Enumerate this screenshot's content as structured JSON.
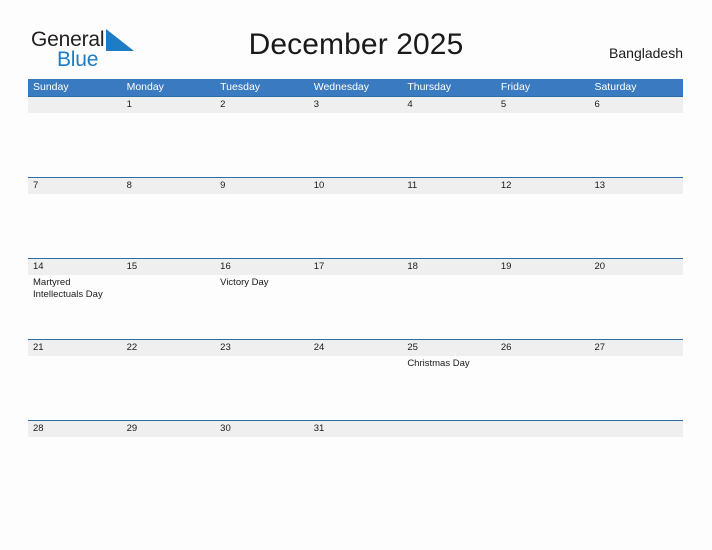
{
  "brand": {
    "name_part1": "General",
    "name_part2": "Blue",
    "flag_icon": "blue-flag-triangle",
    "color_dark": "#231f20",
    "color_blue": "#1d7cc4"
  },
  "header": {
    "title": "December 2025",
    "country": "Bangladesh"
  },
  "theme": {
    "header_bar": "#3a7ac0",
    "row_rule": "#2d6ca8",
    "date_band": "#efefef",
    "page_background": "#fdfdfd",
    "text": "#1a1a1a"
  },
  "weekday_headers": [
    "Sunday",
    "Monday",
    "Tuesday",
    "Wednesday",
    "Thursday",
    "Friday",
    "Saturday"
  ],
  "weeks": [
    {
      "days": [
        {
          "date": "",
          "events": []
        },
        {
          "date": "1",
          "events": []
        },
        {
          "date": "2",
          "events": []
        },
        {
          "date": "3",
          "events": []
        },
        {
          "date": "4",
          "events": []
        },
        {
          "date": "5",
          "events": []
        },
        {
          "date": "6",
          "events": []
        }
      ]
    },
    {
      "days": [
        {
          "date": "7",
          "events": []
        },
        {
          "date": "8",
          "events": []
        },
        {
          "date": "9",
          "events": []
        },
        {
          "date": "10",
          "events": []
        },
        {
          "date": "11",
          "events": []
        },
        {
          "date": "12",
          "events": []
        },
        {
          "date": "13",
          "events": []
        }
      ]
    },
    {
      "days": [
        {
          "date": "14",
          "events": [
            "Martyred Intellectuals Day"
          ]
        },
        {
          "date": "15",
          "events": []
        },
        {
          "date": "16",
          "events": [
            "Victory Day"
          ]
        },
        {
          "date": "17",
          "events": []
        },
        {
          "date": "18",
          "events": []
        },
        {
          "date": "19",
          "events": []
        },
        {
          "date": "20",
          "events": []
        }
      ]
    },
    {
      "days": [
        {
          "date": "21",
          "events": []
        },
        {
          "date": "22",
          "events": []
        },
        {
          "date": "23",
          "events": []
        },
        {
          "date": "24",
          "events": []
        },
        {
          "date": "25",
          "events": [
            "Christmas Day"
          ]
        },
        {
          "date": "26",
          "events": []
        },
        {
          "date": "27",
          "events": []
        }
      ]
    },
    {
      "days": [
        {
          "date": "28",
          "events": []
        },
        {
          "date": "29",
          "events": []
        },
        {
          "date": "30",
          "events": []
        },
        {
          "date": "31",
          "events": []
        },
        {
          "date": "",
          "events": []
        },
        {
          "date": "",
          "events": []
        },
        {
          "date": "",
          "events": []
        }
      ]
    }
  ]
}
